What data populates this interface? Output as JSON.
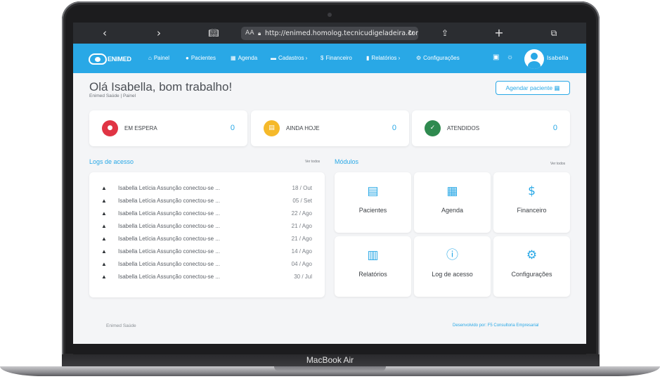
{
  "device": {
    "model_label": "MacBook Air"
  },
  "browser": {
    "back_icon": "chevron-left-icon",
    "forward_icon": "chevron-right-icon",
    "reader_icon": "book-icon",
    "text_size_label": "AA",
    "url": "http://enimed.homolog.tecnicudigeladeira.com.br",
    "share_icon": "share-icon",
    "new_tab_icon": "plus-icon",
    "tabs_icon": "tabs-icon"
  },
  "nav": {
    "brand": "ENIMED",
    "items": [
      {
        "label": "Painel",
        "icon": "home-icon"
      },
      {
        "label": "Pacientes",
        "icon": "user-icon"
      },
      {
        "label": "Agenda",
        "icon": "calendar-icon"
      },
      {
        "label": "Cadastros ›",
        "icon": "folder-icon"
      },
      {
        "label": "Financeiro",
        "icon": "dollar-icon"
      },
      {
        "label": "Relatórios ›",
        "icon": "chart-icon"
      },
      {
        "label": "Configurações",
        "icon": "gear-icon"
      }
    ],
    "user_name": "Isabella"
  },
  "header": {
    "greeting": "Olá Isabella, bom trabalho!",
    "breadcrumb": "Enimed Saúde  |  Painel",
    "schedule_button": "Agendar paciente"
  },
  "stats": [
    {
      "label": "EM ESPERA",
      "count": "0",
      "color": "#e03444"
    },
    {
      "label": "AINDA HOJE",
      "count": "0",
      "color": "#f5b92a"
    },
    {
      "label": "ATENDIDOS",
      "count": "0",
      "color": "#2f8a4f"
    }
  ],
  "logs": {
    "title": "Logs de acesso",
    "see_all": "Ver todos",
    "rows": [
      {
        "text": "Isabella Letícia Assunção conectou-se ...",
        "date": "18 / Out"
      },
      {
        "text": "Isabella Letícia Assunção conectou-se ...",
        "date": "05 / Set"
      },
      {
        "text": "Isabella Letícia Assunção conectou-se ...",
        "date": "22 / Ago"
      },
      {
        "text": "Isabella Letícia Assunção conectou-se ...",
        "date": "21 / Ago"
      },
      {
        "text": "Isabella Letícia Assunção conectou-se ...",
        "date": "21 / Ago"
      },
      {
        "text": "Isabella Letícia Assunção conectou-se ...",
        "date": "14 / Ago"
      },
      {
        "text": "Isabella Letícia Assunção conectou-se ...",
        "date": "04 / Ago"
      },
      {
        "text": "Isabella Letícia Assunção conectou-se ...",
        "date": "30 / Jul"
      }
    ]
  },
  "modules": {
    "title": "Módulos",
    "see_all": "Ver todos",
    "items": [
      {
        "label": "Pacientes",
        "icon": "patients-icon"
      },
      {
        "label": "Agenda",
        "icon": "calendar-icon"
      },
      {
        "label": "Financeiro",
        "icon": "dollar-icon"
      },
      {
        "label": "Relatórios",
        "icon": "chart-icon"
      },
      {
        "label": "Log de acesso",
        "icon": "info-icon"
      },
      {
        "label": "Configurações",
        "icon": "gear-icon"
      }
    ]
  },
  "footer": {
    "left": "Enimed Saúde",
    "right": "Desenvolvido por: F5 Consultoria Empresarial"
  }
}
